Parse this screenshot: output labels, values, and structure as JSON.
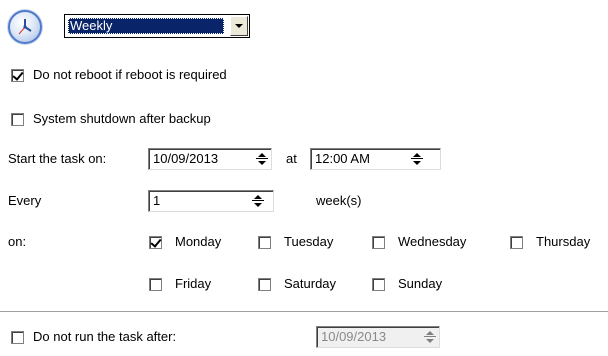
{
  "schedule": {
    "frequency_selected": "Weekly"
  },
  "options": {
    "no_reboot_label": "Do not reboot if reboot is required",
    "no_reboot_checked": true,
    "shutdown_label": "System shutdown after backup",
    "shutdown_checked": false
  },
  "start": {
    "label": "Start the task on:",
    "date": "10/09/2013",
    "at_label": "at",
    "time": "12:00 AM"
  },
  "every": {
    "label": "Every",
    "value": "1",
    "unit": "week(s)"
  },
  "days": {
    "label": "on:",
    "items": [
      {
        "name": "Monday",
        "checked": true
      },
      {
        "name": "Tuesday",
        "checked": false
      },
      {
        "name": "Wednesday",
        "checked": false
      },
      {
        "name": "Thursday",
        "checked": false
      },
      {
        "name": "Friday",
        "checked": false
      },
      {
        "name": "Saturday",
        "checked": false
      },
      {
        "name": "Sunday",
        "checked": false
      }
    ]
  },
  "end": {
    "label": "Do not run the task after:",
    "checked": false,
    "date": "10/09/2013"
  },
  "icons": {
    "schedule": "clock-icon",
    "dropdown": "chevron-down-icon",
    "spinner": "spin-updown-icon"
  },
  "colors": {
    "selection": "#0a246a",
    "icon_ring": "#4f79c9",
    "disabled_text": "#8a8a8a"
  }
}
